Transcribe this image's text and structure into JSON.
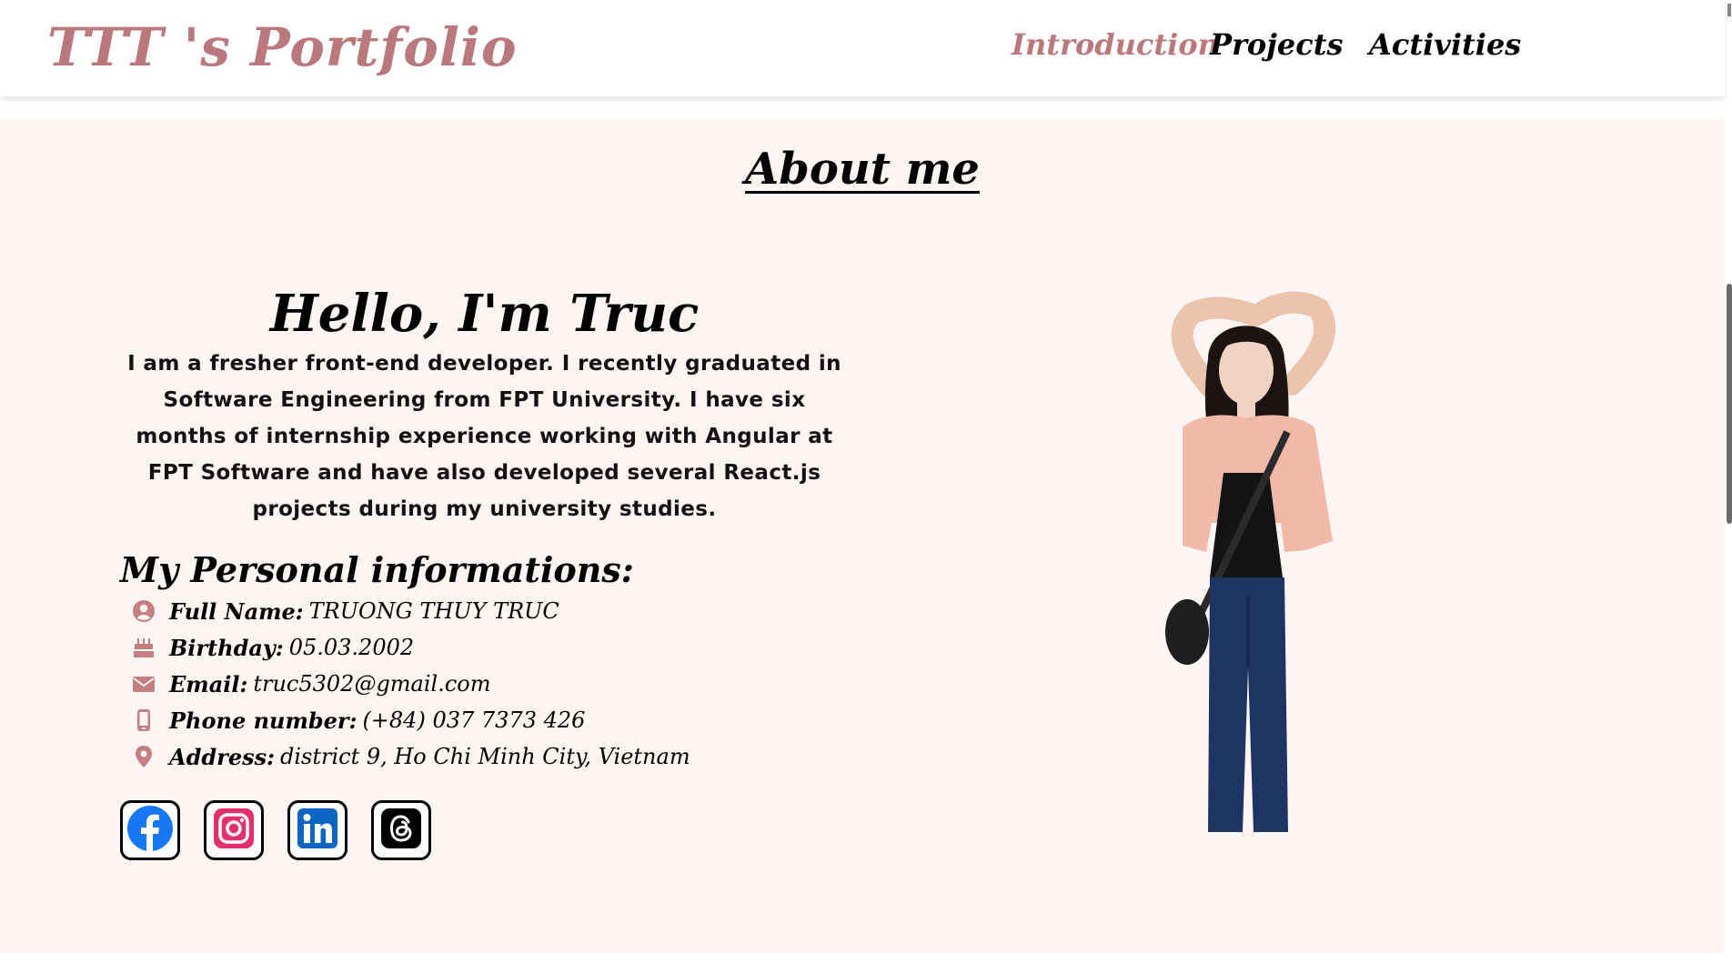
{
  "header": {
    "logo": "TTT 's Portfolio",
    "nav": [
      {
        "label": "Introduction",
        "active": true
      },
      {
        "label": "Projects",
        "active": false
      },
      {
        "label": "Activities",
        "active": false
      }
    ]
  },
  "about": {
    "section_title": "About me",
    "greeting": "Hello, I'm Truc",
    "bio": "I am a fresher front-end developer. I recently graduated in Software Engineering from FPT University. I have six months of internship experience working with Angular at FPT Software and have also developed several React.js projects during my university studies."
  },
  "personal_info": {
    "heading": "My Personal informations:",
    "items": [
      {
        "icon": "user-circle-icon",
        "label": "Full Name:",
        "value": "TRUONG THUY TRUC"
      },
      {
        "icon": "birthday-cake-icon",
        "label": "Birthday:",
        "value": "05.03.2002"
      },
      {
        "icon": "envelope-icon",
        "label": "Email:",
        "value": "truc5302@gmail.com"
      },
      {
        "icon": "mobile-phone-icon",
        "label": "Phone number:",
        "value": "(+84) 037 7373 426"
      },
      {
        "icon": "map-pin-icon",
        "label": "Address:",
        "value": "district 9, Ho Chi Minh City, Vietnam"
      }
    ]
  },
  "socials": [
    "facebook-icon",
    "instagram-icon",
    "linkedin-icon",
    "threads-icon"
  ],
  "colors": {
    "accent": "#b9797c",
    "background": "#fdf5f3",
    "icon": "#c47f83",
    "facebook": "#1877f2",
    "instagram": "#e1306c",
    "linkedin": "#0a66c2"
  }
}
